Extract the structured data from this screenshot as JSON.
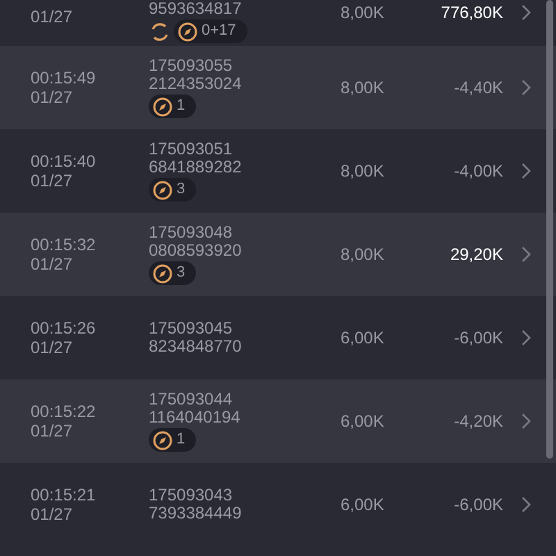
{
  "rows": [
    {
      "date": "01/27",
      "id_2": "9593634817",
      "spin": true,
      "badge": "0+17",
      "stake": "8,00K",
      "result": "776,80K",
      "highlight": true
    },
    {
      "time": "00:15:49",
      "date": "01/27",
      "id_1": "175093055",
      "id_2": "2124353024",
      "spin": false,
      "badge": "1",
      "stake": "8,00K",
      "result": "-4,40K",
      "highlight": false
    },
    {
      "time": "00:15:40",
      "date": "01/27",
      "id_1": "175093051",
      "id_2": "6841889282",
      "spin": false,
      "badge": "3",
      "stake": "8,00K",
      "result": "-4,00K",
      "highlight": false
    },
    {
      "time": "00:15:32",
      "date": "01/27",
      "id_1": "175093048",
      "id_2": "0808593920",
      "spin": false,
      "badge": "3",
      "stake": "8,00K",
      "result": "29,20K",
      "highlight": true
    },
    {
      "time": "00:15:26",
      "date": "01/27",
      "id_1": "175093045",
      "id_2": "8234848770",
      "spin": false,
      "stake": "6,00K",
      "result": "-6,00K",
      "highlight": false
    },
    {
      "time": "00:15:22",
      "date": "01/27",
      "id_1": "175093044",
      "id_2": "1164040194",
      "spin": false,
      "badge": "1",
      "stake": "6,00K",
      "result": "-4,20K",
      "highlight": false
    },
    {
      "time": "00:15:21",
      "date": "01/27",
      "id_1": "175093043",
      "id_2": "7393384449",
      "spin": false,
      "stake": "6,00K",
      "result": "-6,00K",
      "highlight": false
    }
  ]
}
